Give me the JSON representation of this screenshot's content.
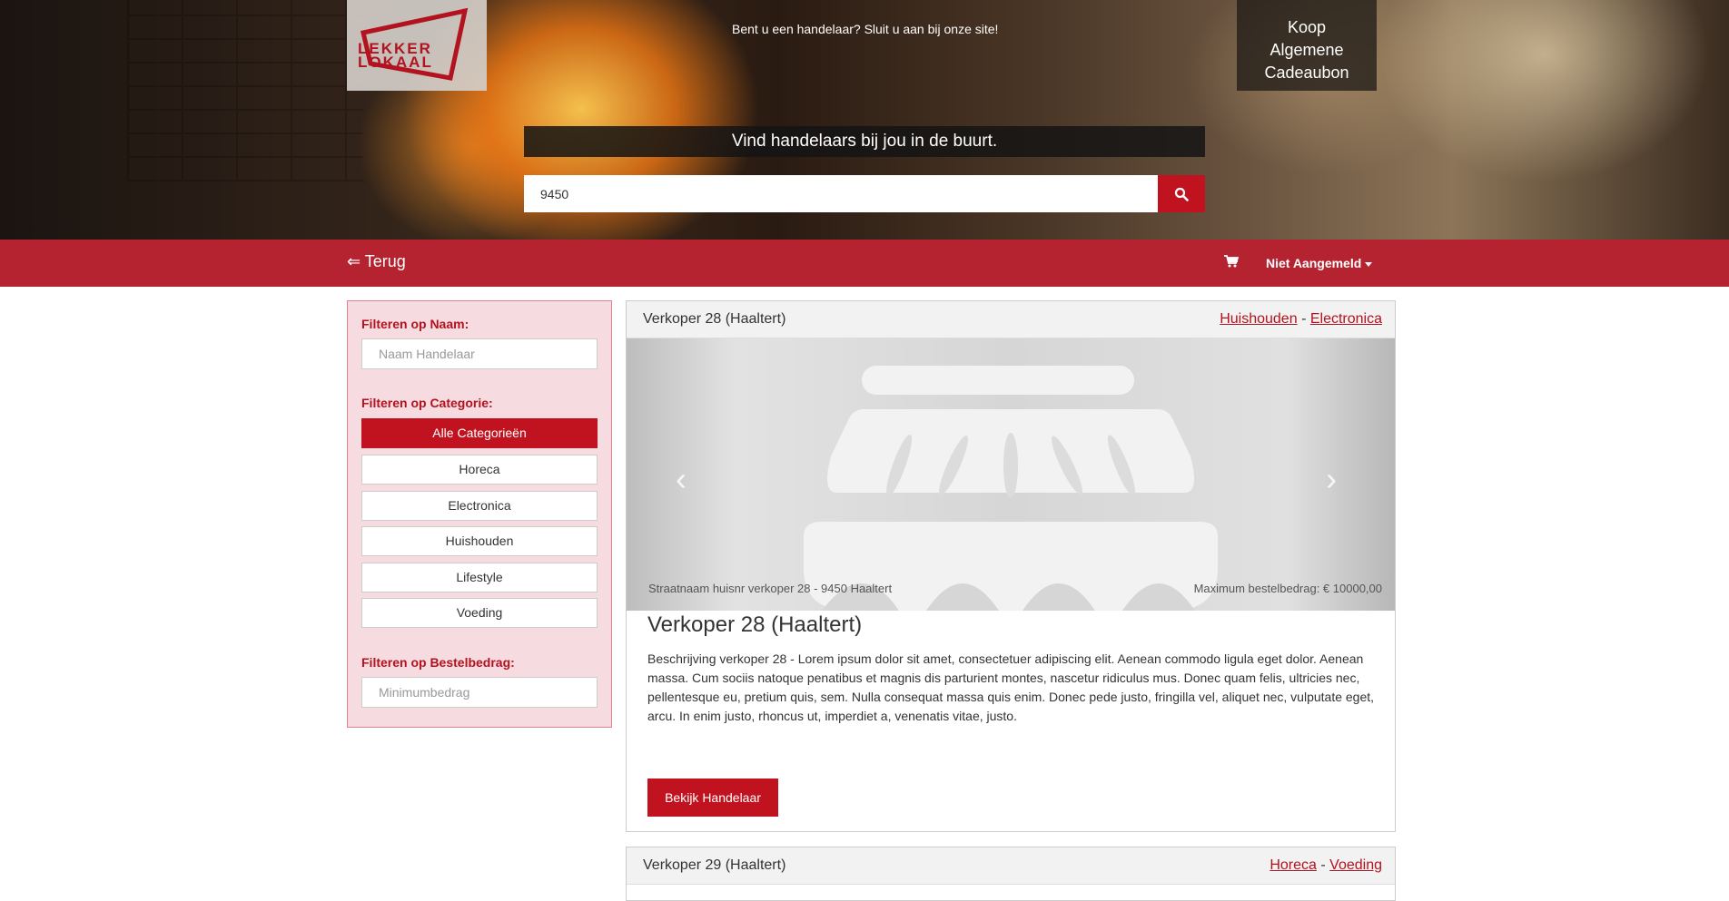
{
  "header": {
    "logo_text_line1": "LEKKER",
    "logo_text_line2": "LOKAAL",
    "merchant_cta": "Bent u een handelaar? Sluit u aan bij onze site!",
    "gift_line1": "Koop",
    "gift_line2": "Algemene",
    "gift_line3": "Cadeaubon",
    "search_title": "Vind handelaars bij jou in de buurt.",
    "search_value": "9450",
    "search_icon": "search-icon"
  },
  "navbar": {
    "back_label": "⇐ Terug",
    "cart_icon": "cart-icon",
    "user_label": "Niet Aangemeld"
  },
  "sidebar": {
    "name_label": "Filteren op Naam:",
    "name_placeholder": "Naam Handelaar",
    "category_label": "Filteren op Categorie:",
    "categories": [
      {
        "label": "Alle Categorieën",
        "active": true
      },
      {
        "label": "Horeca",
        "active": false
      },
      {
        "label": "Electronica",
        "active": false
      },
      {
        "label": "Huishouden",
        "active": false
      },
      {
        "label": "Lifestyle",
        "active": false
      },
      {
        "label": "Voeding",
        "active": false
      }
    ],
    "amount_label": "Filteren op Bestelbedrag:",
    "amount_placeholder": "Minimumbedrag"
  },
  "sellers": [
    {
      "title": "Verkoper 28 (Haaltert)",
      "cat1": "Huishouden",
      "cat2": "Electronica",
      "separator": "-",
      "address": "Straatnaam huisnr verkoper 28 - 9450 Haaltert",
      "max_amount": "Maximum bestelbedrag: € 10000,00",
      "name": "Verkoper 28 (Haaltert)",
      "description": "Beschrijving verkoper 28 - Lorem ipsum dolor sit amet, consectetuer adipiscing elit. Aenean commodo ligula eget dolor. Aenean massa. Cum sociis natoque penatibus et magnis dis parturient montes, nascetur ridiculus mus. Donec quam felis, ultricies nec, pellentesque eu, pretium quis, sem. Nulla consequat massa quis enim. Donec pede justo, fringilla vel, aliquet nec, vulputate eget, arcu. In enim justo, rhoncus ut, imperdiet a, venenatis vitae, justo.",
      "button": "Bekijk Handelaar"
    },
    {
      "title": "Verkoper 29 (Haaltert)",
      "cat1": "Horeca",
      "cat2": "Voeding",
      "separator": "-"
    }
  ],
  "colors": {
    "brand_red": "#c0131f",
    "sidebar_bg": "#f6dce0"
  }
}
